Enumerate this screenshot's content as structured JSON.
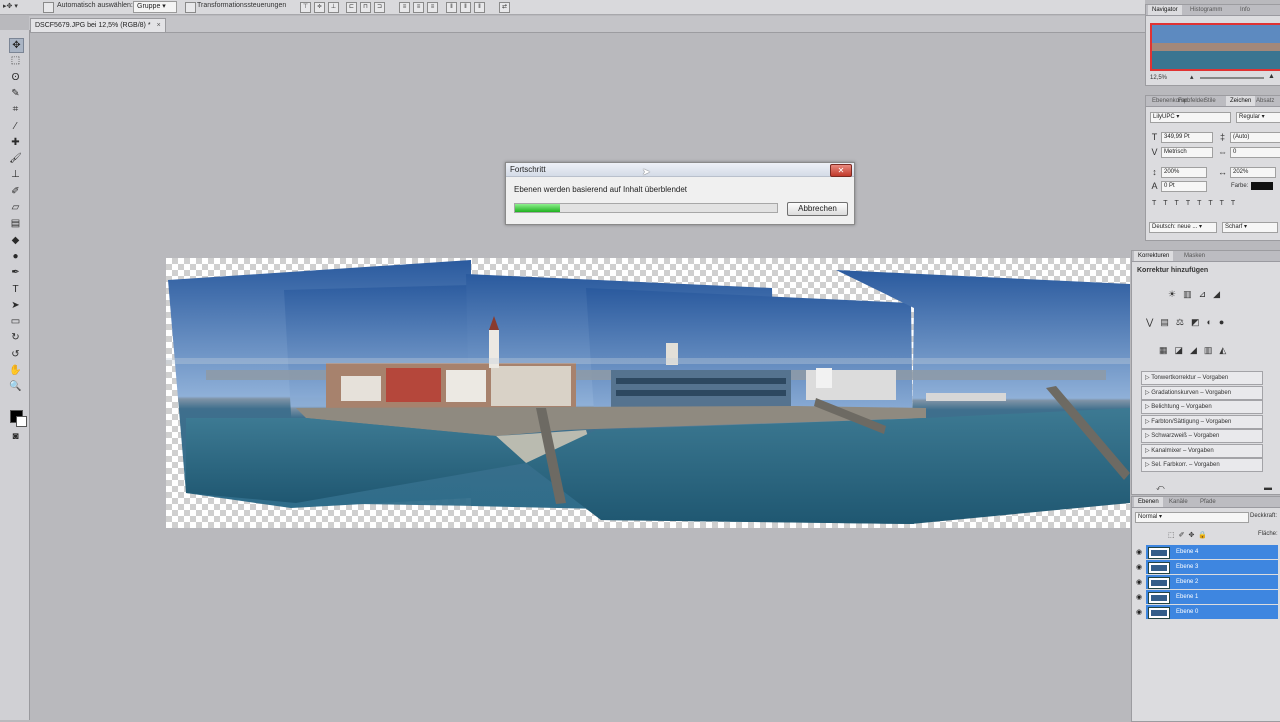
{
  "options_bar": {
    "auto_select_label": "Automatisch auswählen:",
    "auto_select_value": "Gruppe",
    "transform_label": "Transformationssteuerungen"
  },
  "document": {
    "tab_label": "DSCF5679.JPG bei 12,5% (RGB/8) *",
    "close_glyph": "×"
  },
  "toolbox": {
    "tools": [
      {
        "icon": "move-icon",
        "glyph": "✥"
      },
      {
        "icon": "marquee-icon",
        "glyph": "⬚"
      },
      {
        "icon": "lasso-icon",
        "glyph": "ʘ"
      },
      {
        "icon": "quick-select-icon",
        "glyph": "✎"
      },
      {
        "icon": "crop-icon",
        "glyph": "⌗"
      },
      {
        "icon": "eyedropper-icon",
        "glyph": "⁄"
      },
      {
        "icon": "healing-icon",
        "glyph": "✚"
      },
      {
        "icon": "brush-icon",
        "glyph": "🖌"
      },
      {
        "icon": "stamp-icon",
        "glyph": "⊥"
      },
      {
        "icon": "history-brush-icon",
        "glyph": "✐"
      },
      {
        "icon": "eraser-icon",
        "glyph": "▱"
      },
      {
        "icon": "gradient-icon",
        "glyph": "▤"
      },
      {
        "icon": "blur-icon",
        "glyph": "◆"
      },
      {
        "icon": "dodge-icon",
        "glyph": "●"
      },
      {
        "icon": "pen-icon",
        "glyph": "✒"
      },
      {
        "icon": "type-icon",
        "glyph": "T"
      },
      {
        "icon": "path-select-icon",
        "glyph": "➤"
      },
      {
        "icon": "shape-icon",
        "glyph": "▭"
      },
      {
        "icon": "3d-rotate-icon",
        "glyph": "↻"
      },
      {
        "icon": "3d-orbit-icon",
        "glyph": "↺"
      },
      {
        "icon": "hand-icon",
        "glyph": "✋"
      },
      {
        "icon": "zoom-icon",
        "glyph": "🔍"
      }
    ],
    "foreground_color": "#000000",
    "background_color": "#ffffff"
  },
  "dialog": {
    "title": "Fortschritt",
    "message": "Ebenen werden basierend auf Inhalt überblendet",
    "progress": 0.17,
    "cancel_label": "Abbrechen",
    "close_glyph": "✕"
  },
  "navigator": {
    "tab_active": "Navigator",
    "tab_2": "Histogramm",
    "tab_3": "Info",
    "zoom": "12,5%"
  },
  "character": {
    "tabs": [
      "Ebenenkomp.",
      "Farbfelder",
      "Stile",
      "Zeichen",
      "Absatz"
    ],
    "active_tab": "Zeichen",
    "font_family": "LilyUPC",
    "font_style": "Regular",
    "font_size": "349,99 Pt",
    "leading": "(Auto)",
    "kerning": "Metrisch",
    "tracking": "0",
    "vertical_scale": "200%",
    "horizontal_scale": "202%",
    "baseline": "0 Pt",
    "color_label": "Farbe:",
    "language": "Deutsch: neue ...",
    "antialias": "Scharf"
  },
  "adjustments": {
    "tab_active": "Korrekturen",
    "tab_2": "Masken",
    "header": "Korrektur hinzufügen",
    "presets": [
      "Tonwertkorrektur – Vorgaben",
      "Gradationskurven – Vorgaben",
      "Belichtung – Vorgaben",
      "Farbton/Sättigung – Vorgaben",
      "Schwarzweiß – Vorgaben",
      "Kanalmixer – Vorgaben",
      "Sel. Farbkorr. – Vorgaben"
    ]
  },
  "layers": {
    "tab_active": "Ebenen",
    "tab_2": "Kanäle",
    "tab_3": "Pfade",
    "blend_mode": "Normal",
    "opacity_label": "Deckkraft:",
    "fill_label": "Fläche:",
    "items": [
      "Ebene 4",
      "Ebene 3",
      "Ebene 2",
      "Ebene 1",
      "Ebene 0"
    ]
  },
  "colors": {
    "selection_blue": "#3e86e0",
    "progress_green": "#1fb11f"
  }
}
